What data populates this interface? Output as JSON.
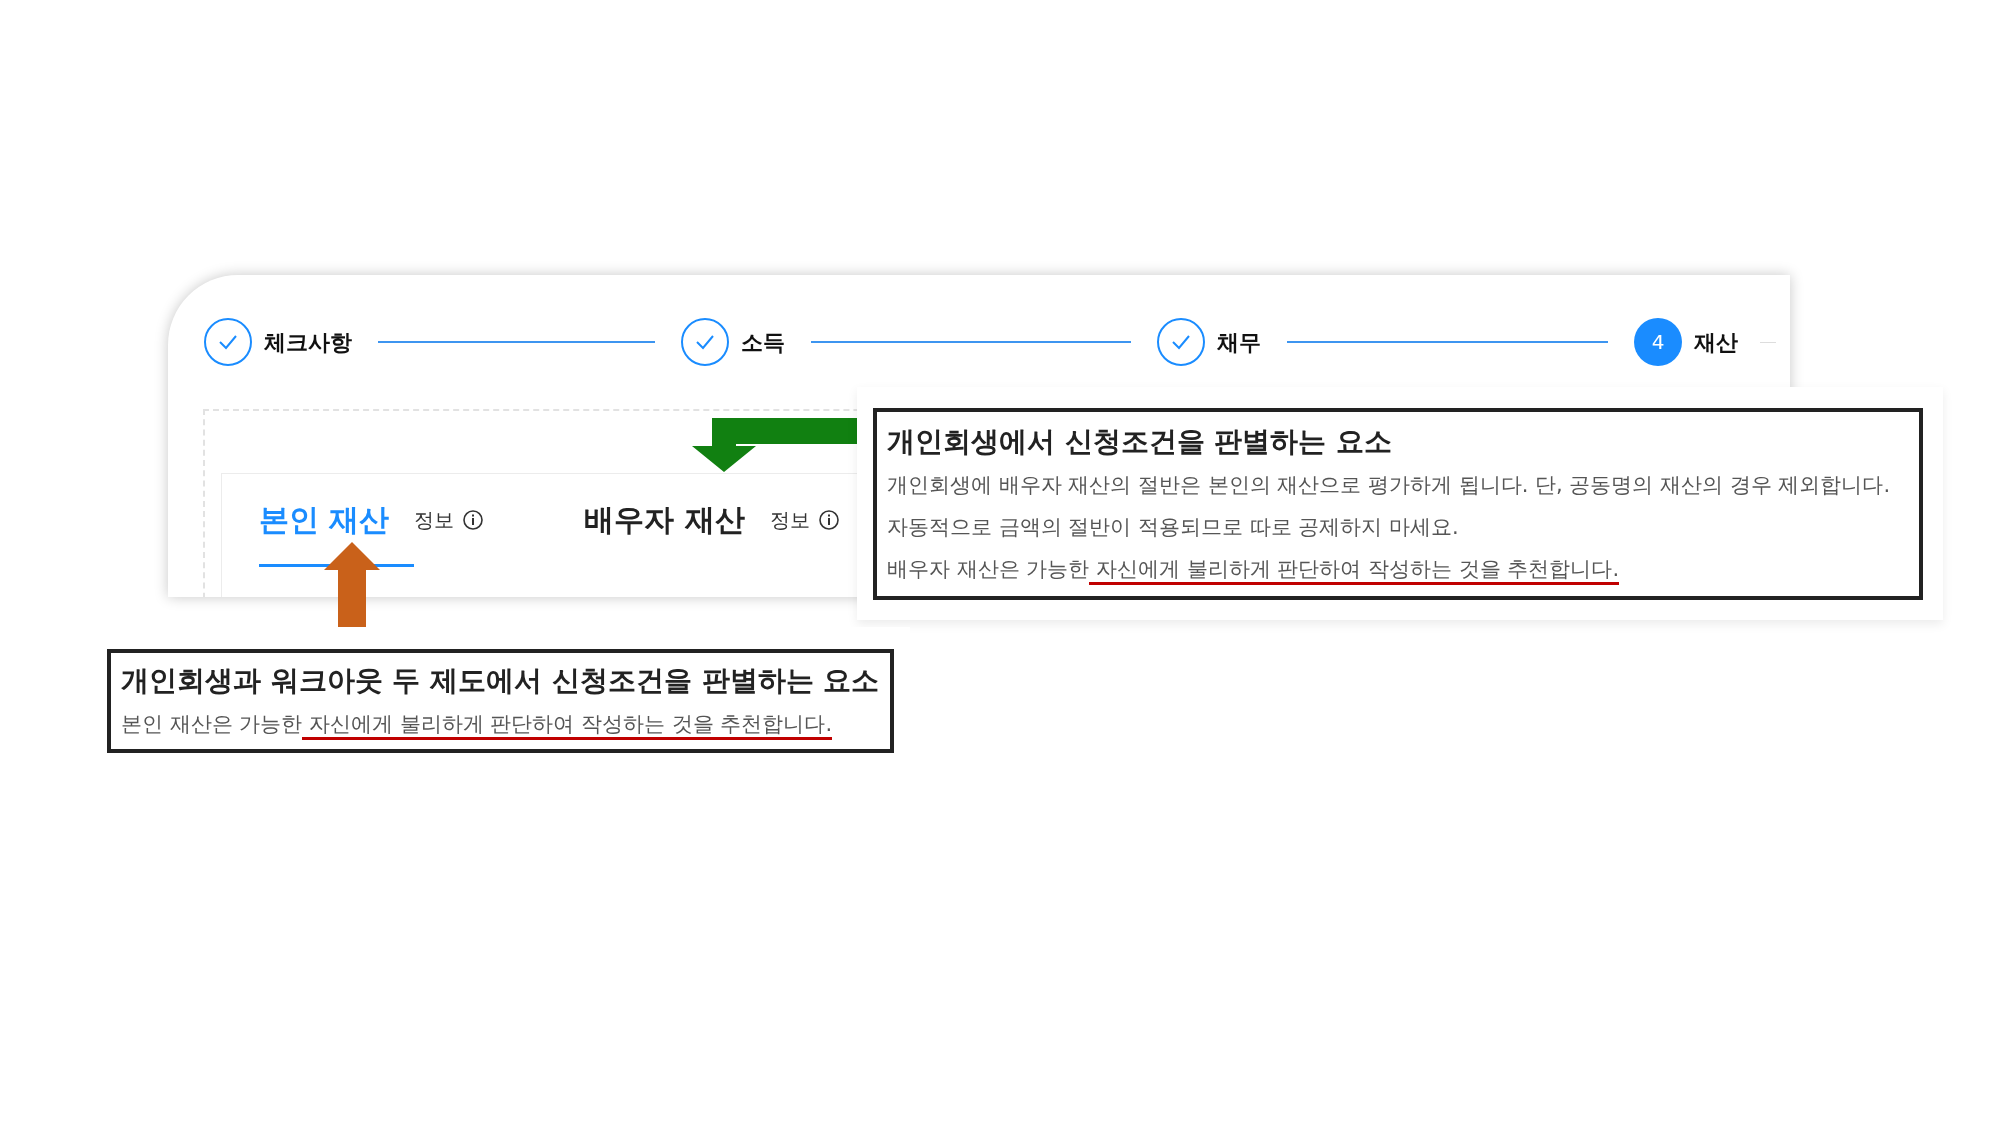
{
  "steps": [
    {
      "label": "체크사항",
      "completed": true
    },
    {
      "label": "소득",
      "completed": true
    },
    {
      "label": "채무",
      "completed": true
    },
    {
      "label": "재산",
      "completed": false,
      "number": "4"
    }
  ],
  "tabs": [
    {
      "label": "본인 재산",
      "info": "정보",
      "selected": true
    },
    {
      "label": "배우자 재산",
      "info": "정보",
      "selected": false
    }
  ],
  "spouse_callout": {
    "title": "개인회생에서 신청조건을 판별하는 요소",
    "lines": [
      {
        "text": "개인회생에 배우자 재산의 절반은 본인의 재산으로 평가하게 됩니다. 단, 공동명의 재산의 경우 제외합니다."
      },
      {
        "text": "자동적으로 금액의 절반이 적용되므로 따로 공제하지 마세요."
      },
      {
        "text": "배우자 재산은 가능한",
        "underlined": " 자신에게 불리하게 판단하여 작성하는 것을 추천합니다."
      }
    ]
  },
  "self_callout": {
    "title": "개인회생과 워크아웃 두 제도에서 신청조건을 판별하는 요소",
    "lines": [
      {
        "text": "본인 재산은 가능한",
        "underlined": " 자신에게 불리하게 판단하여 작성하는 것을 추천합니다."
      }
    ]
  }
}
